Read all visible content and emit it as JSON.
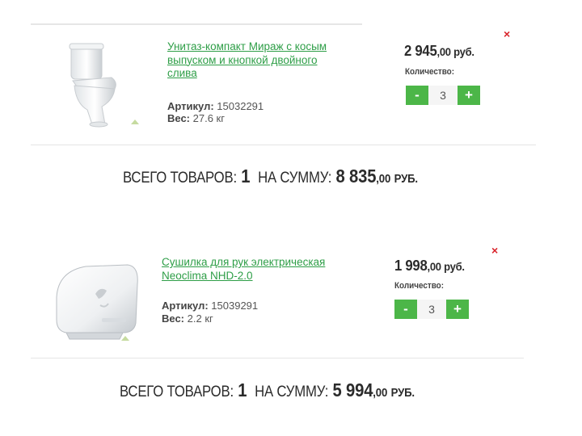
{
  "items": [
    {
      "name": "Унитаз-компакт Мираж с косым выпуском и кнопкой двойного слива",
      "article_label": "Артикул:",
      "article": "15032291",
      "weight_label": "Вес:",
      "weight": "27.6 кг",
      "price_int": "2 945",
      "price_dec": ",00 руб.",
      "qty_label": "Количество:",
      "qty": "3",
      "minus": "-",
      "plus": "+",
      "remove": "×"
    },
    {
      "name": "Сушилка для рук электрическая Neoclima NHD-2.0",
      "article_label": "Артикул:",
      "article": "15039291",
      "weight_label": "Вес:",
      "weight": "2.2 кг",
      "price_int": "1 998",
      "price_dec": ",00 руб.",
      "qty_label": "Количество:",
      "qty": "3",
      "minus": "-",
      "plus": "+",
      "remove": "×"
    }
  ],
  "totals": [
    {
      "count_label": "ВСЕГО ТОВАРОВ:",
      "count": "1",
      "sum_label": "НА СУММУ:",
      "sum_int": "8 835",
      "sum_dec": ",00",
      "currency": "РУБ."
    },
    {
      "count_label": "ВСЕГО ТОВАРОВ:",
      "count": "1",
      "sum_label": "НА СУММУ:",
      "sum_int": "5 994",
      "sum_dec": ",00",
      "currency": "РУБ."
    }
  ],
  "colors": {
    "accent": "#4cb648",
    "link": "#2e9e47",
    "remove": "#d9242b"
  }
}
